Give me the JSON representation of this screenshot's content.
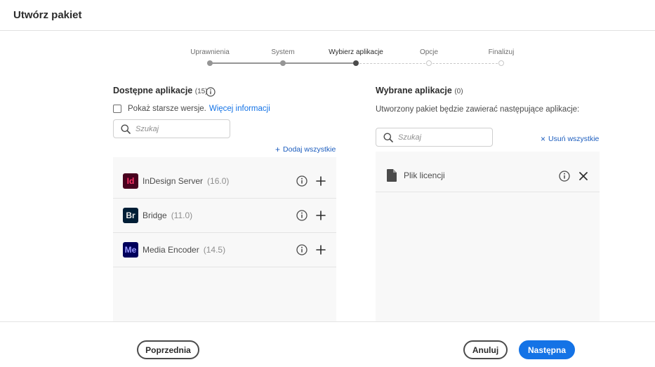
{
  "header": {
    "title": "Utwórz pakiet"
  },
  "stepper": {
    "steps": [
      {
        "label": "Uprawnienia",
        "state": "done"
      },
      {
        "label": "System",
        "state": "done"
      },
      {
        "label": "Wybierz aplikacje",
        "state": "current"
      },
      {
        "label": "Opcje",
        "state": "todo"
      },
      {
        "label": "Finalizuj",
        "state": "todo"
      }
    ]
  },
  "available": {
    "title": "Dostępne aplikacje",
    "count": "(15)",
    "show_older_label": "Pokaż starsze wersje.",
    "more_info_link": "Więcej informacji",
    "search_placeholder": "Szukaj",
    "add_all_label": "Dodaj wszystkie",
    "apps": [
      {
        "code": "Id",
        "name": "InDesign Server",
        "version": "(16.0)",
        "logo_bg": "#49021f",
        "logo_fg": "#ff3366",
        "icon": "indesign-logo-icon"
      },
      {
        "code": "Br",
        "name": "Bridge",
        "version": "(11.0)",
        "logo_bg": "#001e36",
        "logo_fg": "#e8e8e8",
        "icon": "bridge-logo-icon"
      },
      {
        "code": "Me",
        "name": "Media Encoder",
        "version": "(14.5)",
        "logo_bg": "#00005b",
        "logo_fg": "#9999ff",
        "icon": "media-encoder-logo-icon"
      }
    ]
  },
  "selected": {
    "title": "Wybrane aplikacje",
    "count": "(0)",
    "subtitle": "Utworzony pakiet będzie zawierać następujące aplikacje:",
    "search_placeholder": "Szukaj",
    "remove_all_label": "Usuń wszystkie",
    "items": [
      {
        "name": "Plik licencji",
        "icon": "file-icon"
      }
    ]
  },
  "footer": {
    "previous_label": "Poprzednia",
    "cancel_label": "Anuluj",
    "next_label": "Następna"
  },
  "colors": {
    "accent": "#1473e6",
    "link": "#1c5dbe",
    "panel_bg": "#f8f8f8"
  }
}
